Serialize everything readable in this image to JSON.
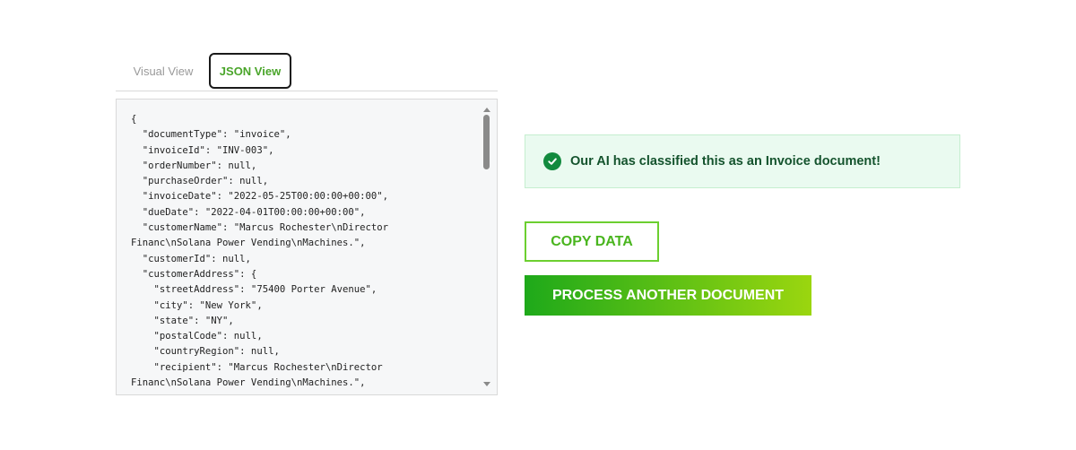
{
  "tabs": {
    "visual_label": "Visual View",
    "json_label": "JSON View"
  },
  "json_view": {
    "lines": [
      "{",
      "  \"documentType\": \"invoice\",",
      "  \"invoiceId\": \"INV-003\",",
      "  \"orderNumber\": null,",
      "  \"purchaseOrder\": null,",
      "  \"invoiceDate\": \"2022-05-25T00:00:00+00:00\",",
      "  \"dueDate\": \"2022-04-01T00:00:00+00:00\",",
      "  \"customerName\": \"Marcus Rochester\\nDirector",
      "Financ\\nSolana Power Vending\\nMachines.\",",
      "  \"customerId\": null,",
      "  \"customerAddress\": {",
      "    \"streetAddress\": \"75400 Porter Avenue\",",
      "    \"city\": \"New York\",",
      "    \"state\": \"NY\",",
      "    \"postalCode\": null,",
      "    \"countryRegion\": null,",
      "    \"recipient\": \"Marcus Rochester\\nDirector",
      "Financ\\nSolana Power Vending\\nMachines.\","
    ]
  },
  "banner": {
    "icon": "check-circle-icon",
    "text": "Our AI has classified this as an Invoice document!"
  },
  "actions": {
    "copy_label": "COPY DATA",
    "process_label": "PROCESS ANOTHER DOCUMENT"
  },
  "colors": {
    "accent_green": "#4aa52a",
    "banner_bg": "#eafaf0",
    "banner_text": "#14532d"
  }
}
